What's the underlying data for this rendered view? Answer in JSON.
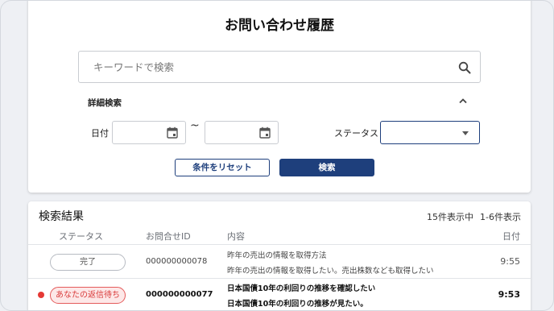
{
  "search": {
    "title": "お問い合わせ履歴",
    "keyword_placeholder": "キーワードで検索",
    "keyword_value": "",
    "advanced_label": "詳細検索",
    "date_label": "日付",
    "date_from_value": "",
    "date_to_value": "",
    "date_separator": "~",
    "status_label": "ステータス",
    "status_selected": "",
    "reset_label": "条件をリセット",
    "search_label": "検索"
  },
  "results": {
    "title": "検索結果",
    "count_total": "15件表示中",
    "count_range": "1-6件表示",
    "columns": {
      "status": "ステータス",
      "id": "お問合せID",
      "content": "内容",
      "date": "日付"
    },
    "rows": [
      {
        "status": "完了",
        "id": "000000000078",
        "subject": "昨年の売出の情報を取得方法",
        "body": "昨年の売出の情報を取得したい。売出株数なども取得したい",
        "date": "9:55"
      },
      {
        "status": "あなたの返信待ち",
        "id": "000000000077",
        "subject": "日本国債10年の利回りの推移を確認したい",
        "body": "日本国債10年の利回りの推移が見たい。",
        "date": "9:53"
      }
    ]
  },
  "colors": {
    "primary": "#1e3f7c",
    "unread_dot": "#e53935",
    "waiting_badge_text": "#d93b3b",
    "waiting_badge_bg": "#fde8e8"
  },
  "icons": {
    "search": "search-icon",
    "collapse": "chevron-up-icon",
    "calendar": "calendar-icon",
    "dropdown": "caret-down-icon"
  }
}
